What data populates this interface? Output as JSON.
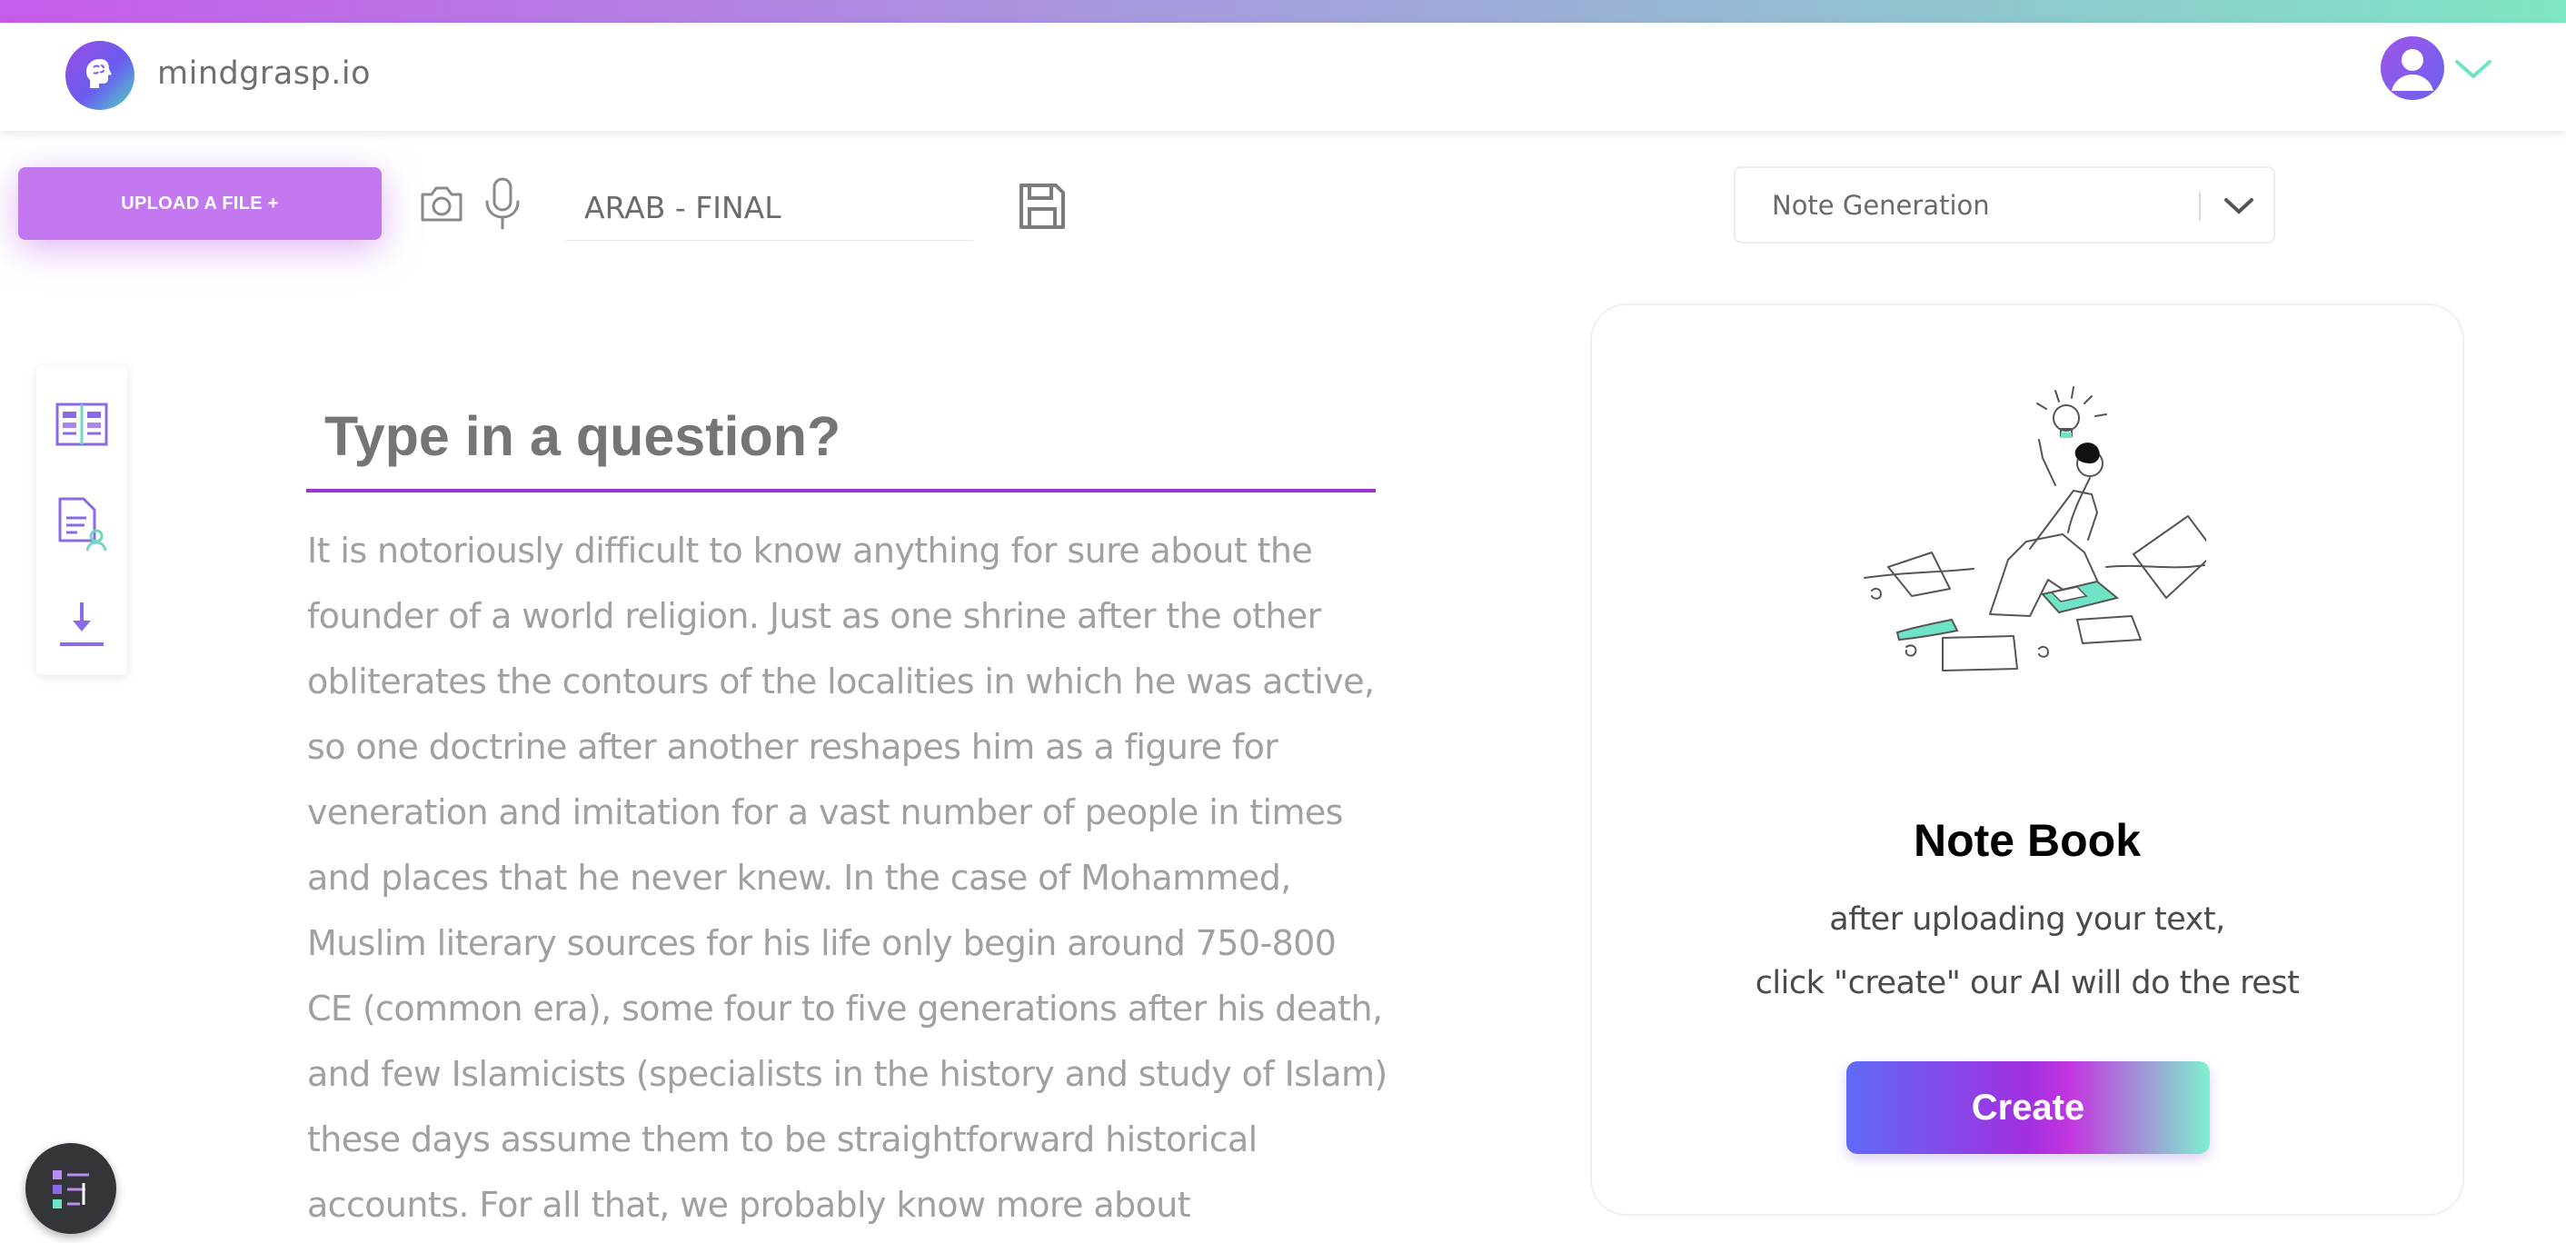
{
  "header": {
    "brand": "mindgrasp.io",
    "logo_icon": "brain-icon",
    "user_icon": "user-avatar-icon",
    "menu_icon": "chevron-down-icon"
  },
  "toolbar": {
    "upload_label": "UPLOAD A FILE +",
    "camera_icon": "camera-icon",
    "mic_icon": "microphone-icon",
    "filename_value": "ARAB - FINAL",
    "save_icon": "save-icon",
    "mode_select_value": "Note Generation"
  },
  "side_tools": [
    "book-icon",
    "document-user-icon",
    "download-icon"
  ],
  "main": {
    "question_placeholder": "Type in a question?",
    "passage": "It is notoriously difficult to know anything for sure about the founder of a world religion. Just as one shrine after the other obliterates the contours of the localities in which he was active, so one doctrine after another reshapes him as a figure for veneration and imitation for a vast number of people in times and places that he never knew. In the case of Mohammed, Muslim literary sources for his life only begin around 750-800 CE (common era), some four to five generations after his death, and few Islamicists (specialists in the history and study of Islam) these days assume them to be straightforward historical accounts. For all that, we probably know more about Mohammed than we do about Jesus (let alone Moses"
  },
  "card": {
    "title": "Note Book",
    "line1": "after uploading your text,",
    "line2": "click \"create\" our AI will do the rest",
    "create_label": "Create",
    "illustration": "person-studying-illustration"
  },
  "fab_icon": "tasks-icon",
  "colors": {
    "accent_purple": "#9b35d6",
    "upload_button": "#c478ef",
    "teal": "#7fe6c4"
  }
}
